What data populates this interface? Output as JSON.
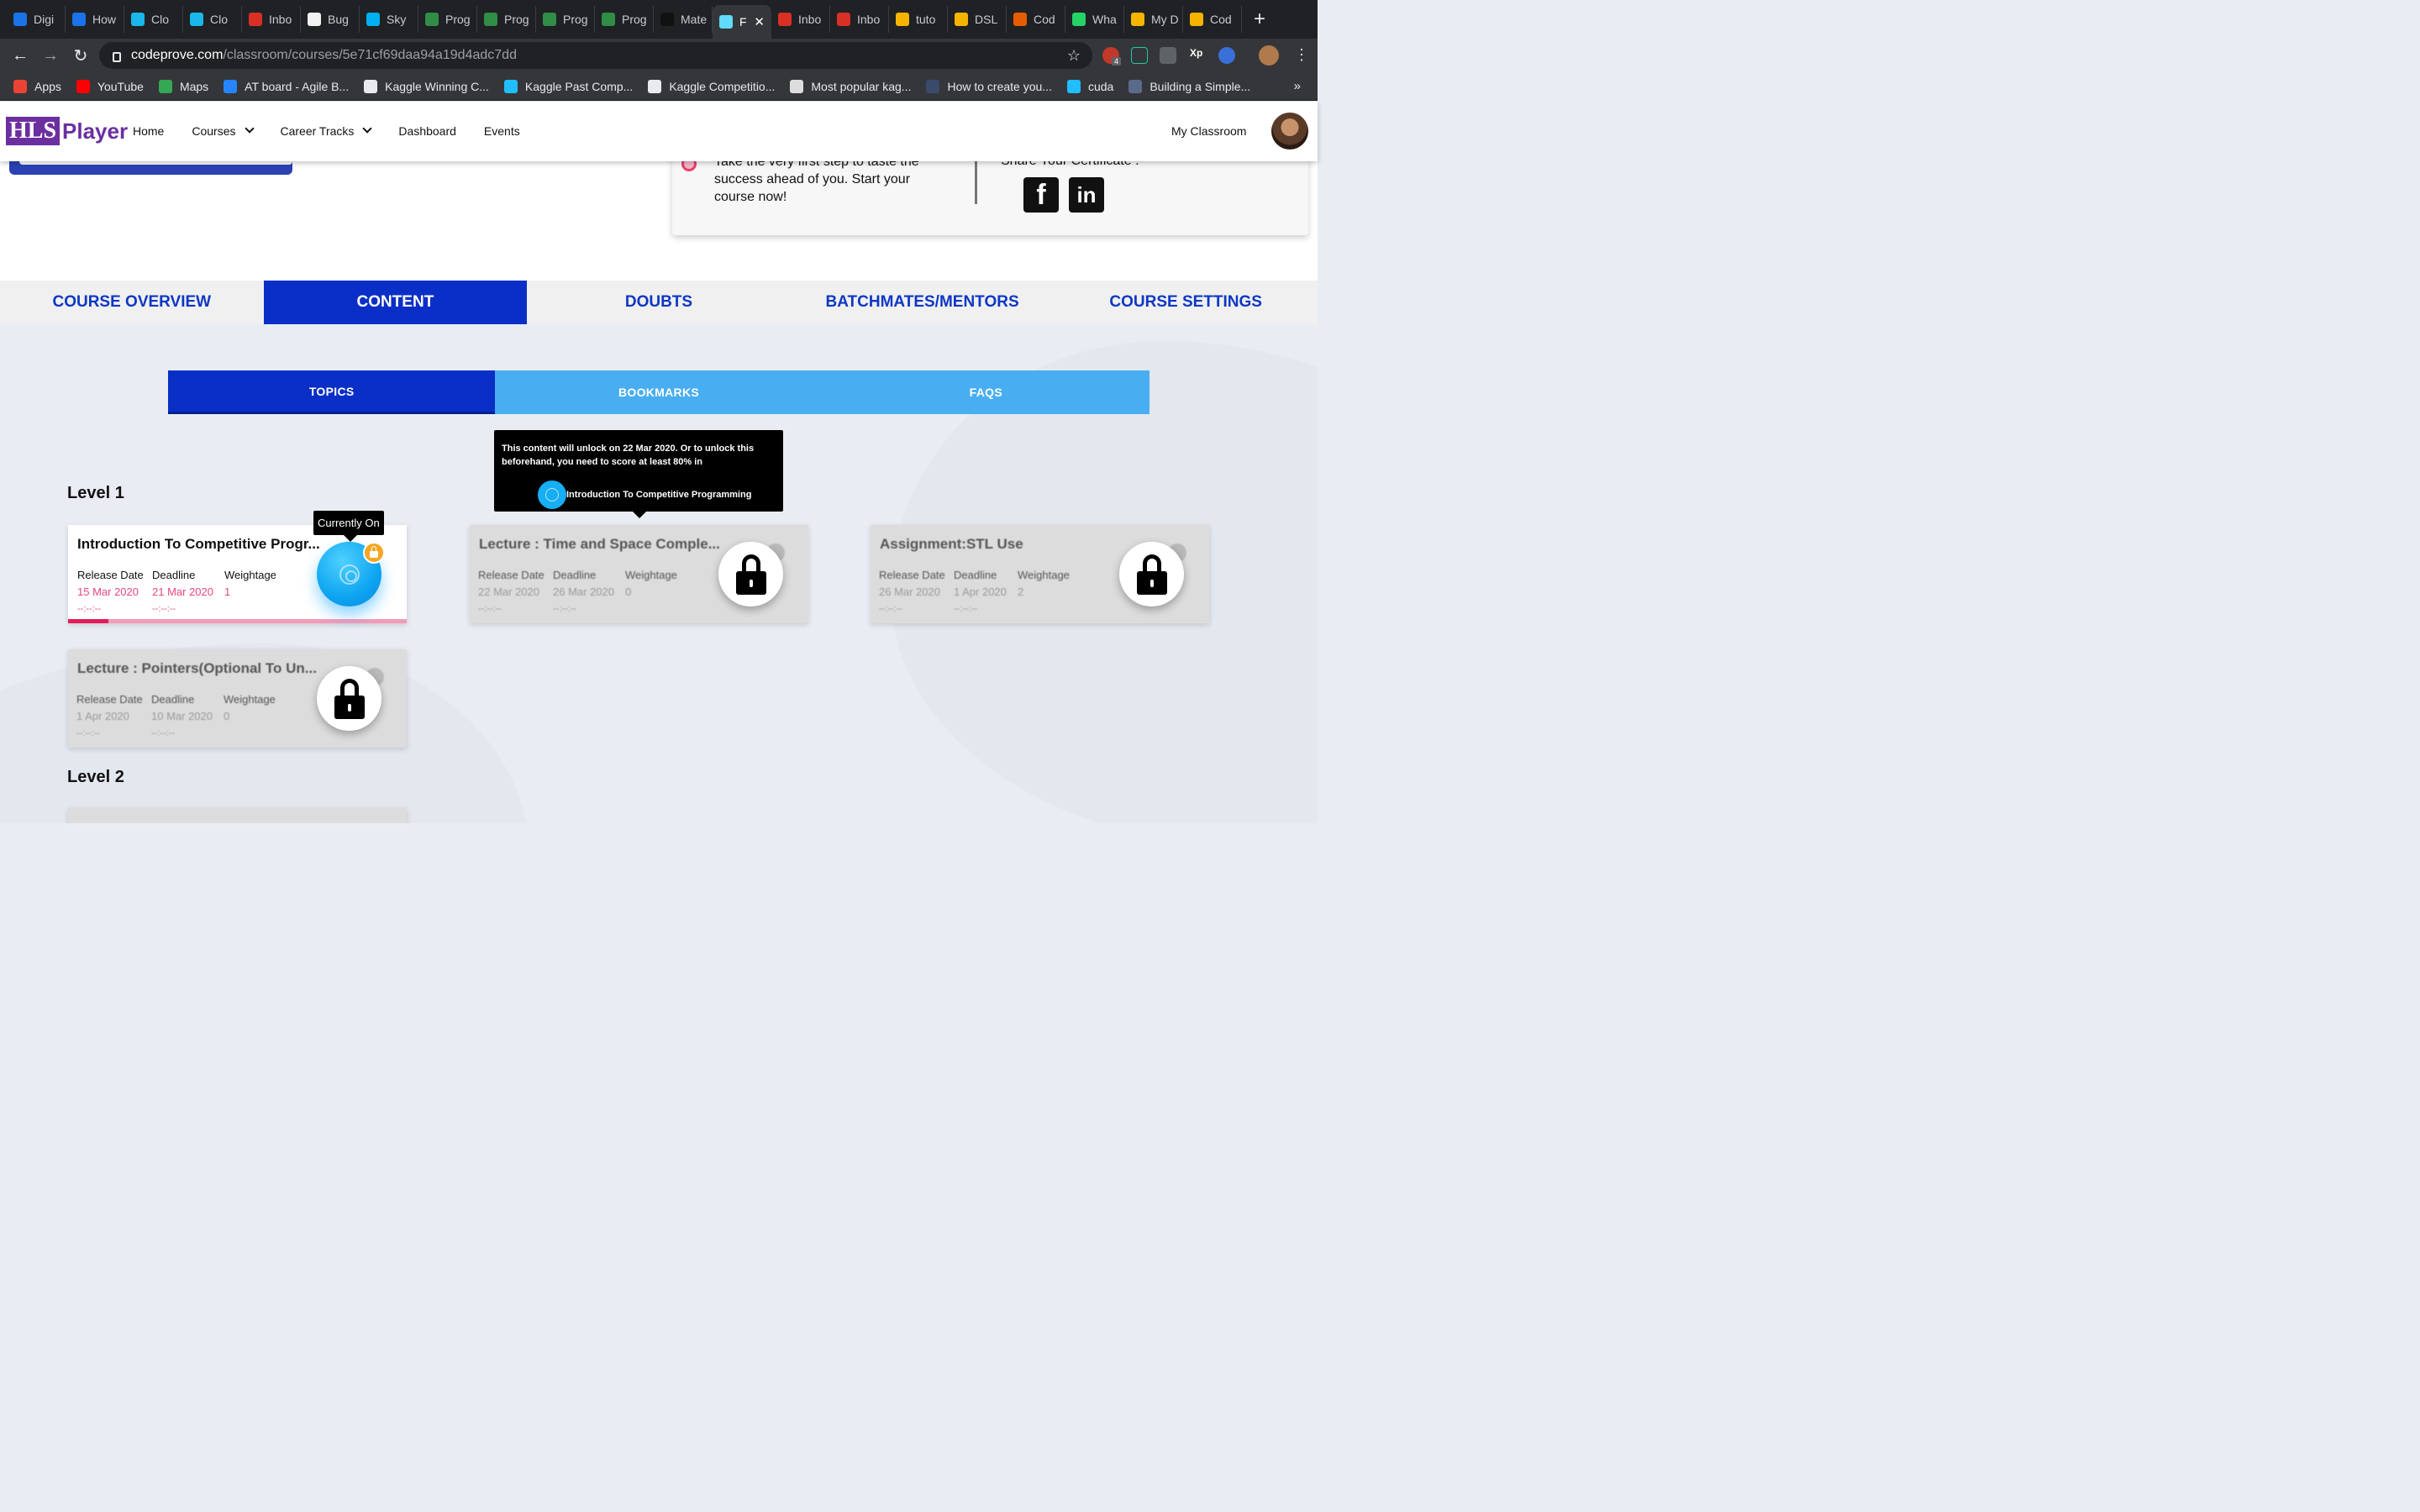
{
  "browser": {
    "tabs": [
      {
        "label": "Digi",
        "color": "#1a73e8"
      },
      {
        "label": "How",
        "color": "#1a73e8"
      },
      {
        "label": "Clo",
        "color": "#1ab7ea"
      },
      {
        "label": "Clo",
        "color": "#1ab7ea"
      },
      {
        "label": "Inbo",
        "color": "#d93025"
      },
      {
        "label": "Bug",
        "color": "#f2f2f2"
      },
      {
        "label": "Sky",
        "color": "#00aff0"
      },
      {
        "label": "Prog",
        "color": "#2f8d46"
      },
      {
        "label": "Prog",
        "color": "#2f8d46"
      },
      {
        "label": "Prog",
        "color": "#2f8d46"
      },
      {
        "label": "Prog",
        "color": "#2f8d46"
      },
      {
        "label": "Mate",
        "color": "#111111"
      },
      {
        "label": "F",
        "color": "#61dafb",
        "active": true
      },
      {
        "label": "Inbo",
        "color": "#d93025"
      },
      {
        "label": "Inbo",
        "color": "#d93025"
      },
      {
        "label": "tuto",
        "color": "#f4b400"
      },
      {
        "label": "DSL",
        "color": "#f4b400"
      },
      {
        "label": "Cod",
        "color": "#e65c00"
      },
      {
        "label": "Wha",
        "color": "#25d366"
      },
      {
        "label": "My D",
        "color": "#f4b400"
      },
      {
        "label": "Cod",
        "color": "#f4b400"
      }
    ],
    "url_host": "codeprove.com",
    "url_path": "/classroom/courses/5e71cf69daa94a19d4adc7dd",
    "ext_badge": "4",
    "bookmarks": [
      {
        "label": "Apps",
        "color": "#ea4335"
      },
      {
        "label": "YouTube",
        "color": "#ff0000"
      },
      {
        "label": "Maps",
        "color": "#34a853"
      },
      {
        "label": "AT board - Agile B...",
        "color": "#2684ff"
      },
      {
        "label": "Kaggle Winning C...",
        "color": "#e8eaed"
      },
      {
        "label": "Kaggle Past Comp...",
        "color": "#20beff"
      },
      {
        "label": "Kaggle Competitio...",
        "color": "#e8eaed"
      },
      {
        "label": "Most popular kag...",
        "color": "#dddddd"
      },
      {
        "label": "How to create you...",
        "color": "#3a4a6a"
      },
      {
        "label": "cuda",
        "color": "#20beff"
      },
      {
        "label": "Building a Simple...",
        "color": "#5a6a8a"
      }
    ],
    "more": "»"
  },
  "site": {
    "logo_hls": "HLS",
    "logo_player": "Player",
    "nav": {
      "home": "Home",
      "courses": "Courses",
      "career": "Career Tracks",
      "dashboard": "Dashboard",
      "events": "Events"
    },
    "my_classroom": "My Classroom"
  },
  "hero": {
    "message": "Take the very first step to taste the success ahead of you. Start your course now!",
    "share": "Share Your Certificate :",
    "fb": "f",
    "li": "in"
  },
  "course_tabs": [
    "COURSE OVERVIEW",
    "CONTENT",
    "DOUBTS",
    "BATCHMATES/MENTORS",
    "COURSE SETTINGS"
  ],
  "sub_tabs": [
    "TOPICS",
    "BOOKMARKS",
    "FAQS"
  ],
  "levels": {
    "l1": "Level 1",
    "l2": "Level 2"
  },
  "meta_labels": {
    "release": "Release Date",
    "deadline": "Deadline",
    "weightage": "Weightage",
    "time_placeholder": "--:--:--"
  },
  "cards": [
    {
      "title": "Introduction To Competitive Progr...",
      "release": "15 Mar 2020",
      "deadline": "21 Mar 2020",
      "weightage": "1",
      "progress": 0.12
    },
    {
      "title": "Lecture : Time and Space Comple...",
      "release": "22 Mar 2020",
      "deadline": "26 Mar 2020",
      "weightage": "0"
    },
    {
      "title": "Assignment:STL Use",
      "release": "26 Mar 2020",
      "deadline": "1 Apr 2020",
      "weightage": "2"
    },
    {
      "title": "Lecture : Pointers(Optional To Un...",
      "release": "1 Apr 2020",
      "deadline": "10 Mar 2020",
      "weightage": "0"
    }
  ],
  "tooltips": {
    "current": "Currently On",
    "unlock": "This content will unlock on 22 Mar 2020. Or to unlock this beforehand, you need to score at least 80% in",
    "unlock_ref": "Introduction To Competitive Programming"
  }
}
